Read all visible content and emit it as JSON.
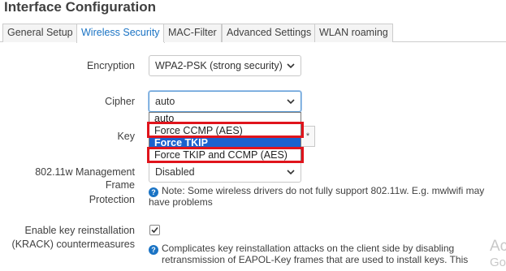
{
  "page": {
    "title": "Interface Configuration"
  },
  "tabs": [
    {
      "label": "General Setup",
      "active": false
    },
    {
      "label": "Wireless Security",
      "active": true
    },
    {
      "label": "MAC-Filter",
      "active": false
    },
    {
      "label": "Advanced Settings",
      "active": false
    },
    {
      "label": "WLAN roaming",
      "active": false
    }
  ],
  "form": {
    "encryption": {
      "label": "Encryption",
      "value": "WPA2-PSK (strong security)"
    },
    "cipher": {
      "label": "Cipher",
      "value": "auto",
      "options": [
        "auto",
        "Force CCMP (AES)",
        "Force TKIP",
        "Force TKIP and CCMP (AES)"
      ],
      "highlighted": "Force TKIP"
    },
    "key": {
      "label": "Key",
      "reveal_symbol": "*"
    },
    "mgmt_frame": {
      "label_line1": "802.11w Management Frame",
      "label_line2": "Protection",
      "value": "Disabled",
      "help": "Note: Some wireless drivers do not fully support 802.11w. E.g. mwlwifi may have problems"
    },
    "krack": {
      "label_line1": "Enable key reinstallation",
      "label_line2": "(KRACK) countermeasures",
      "checked": true,
      "help_line1": "Complicates key reinstallation attacks on the client side by disabling",
      "help_line2": "retransmission of EAPOL-Key frames that are used to install keys. This"
    }
  },
  "watermark": {
    "line1": "Ac",
    "line2": "Go"
  },
  "colors": {
    "accent": "#1a73c4",
    "highlight": "#1a62cf",
    "annotation": "#e0141c"
  }
}
